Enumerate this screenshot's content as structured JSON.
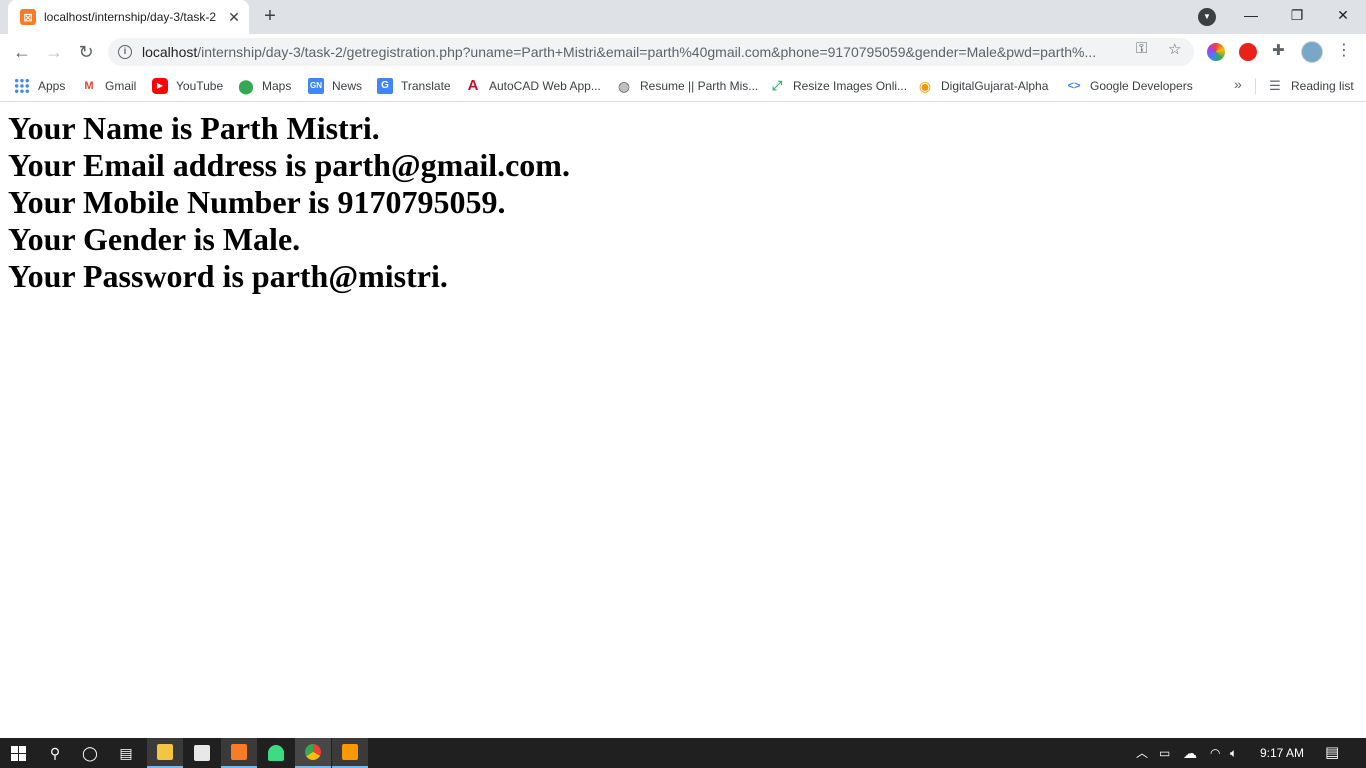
{
  "browser": {
    "tab": {
      "title": "localhost/internship/day-3/task-2",
      "favicon": "xampp-icon"
    },
    "url_host": "localhost",
    "url_path": "/internship/day-3/task-2/getregistration.php?uname=Parth+Mistri&email=parth%40gmail.com&phone=9170795059&gender=Male&pwd=parth%..."
  },
  "bookmarks": {
    "items": [
      {
        "label": "Apps",
        "icon": "apps-grid-icon"
      },
      {
        "label": "Gmail",
        "icon": "gmail-icon"
      },
      {
        "label": "YouTube",
        "icon": "youtube-icon"
      },
      {
        "label": "Maps",
        "icon": "maps-icon"
      },
      {
        "label": "News",
        "icon": "news-icon"
      },
      {
        "label": "Translate",
        "icon": "translate-icon"
      },
      {
        "label": "AutoCAD Web App...",
        "icon": "autocad-icon"
      },
      {
        "label": "Resume || Parth Mis...",
        "icon": "globe-icon"
      },
      {
        "label": "Resize Images Onli...",
        "icon": "resize-icon"
      },
      {
        "label": "DigitalGujarat-Alpha",
        "icon": "digitalgujarat-icon"
      },
      {
        "label": "Google Developers",
        "icon": "google-developers-icon"
      }
    ],
    "reading_list": "Reading list"
  },
  "page": {
    "lines": [
      "Your Name is Parth Mistri.",
      "Your Email address is parth@gmail.com.",
      "Your Mobile Number is 9170795059.",
      "Your Gender is Male.",
      "Your Password is parth@mistri."
    ]
  },
  "taskbar": {
    "time": "9:17 AM"
  }
}
